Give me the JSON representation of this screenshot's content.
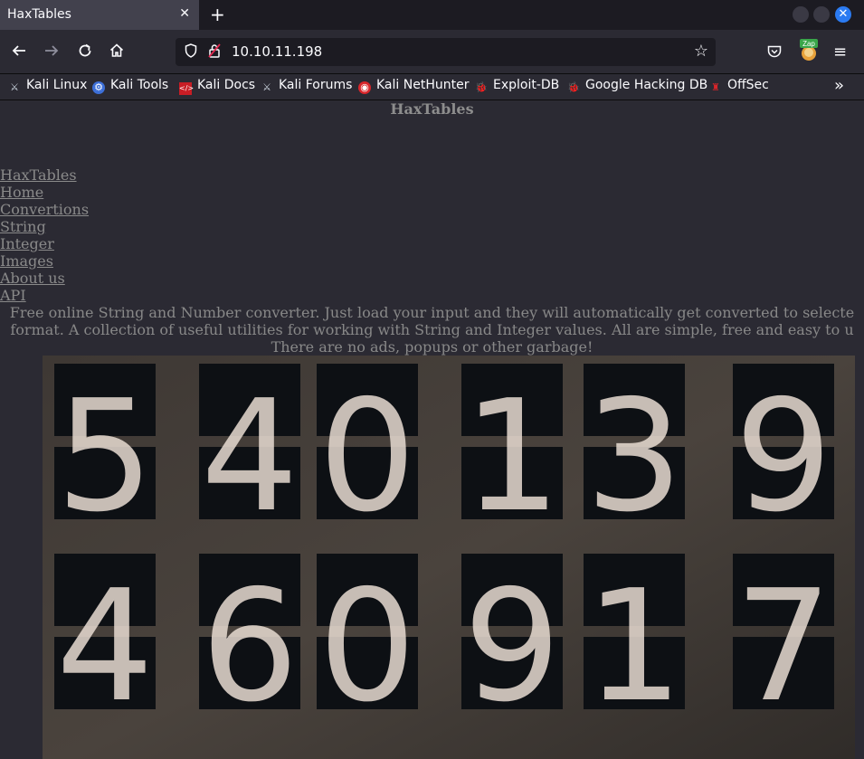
{
  "browser": {
    "tab_title": "HaxTables",
    "tab_close": "✕",
    "new_tab": "+",
    "url": "10.10.11.198",
    "zap_badge": "Zap",
    "bookmarks": [
      {
        "label": "Kali Linux",
        "icon": "kali-linux-icon"
      },
      {
        "label": "Kali Tools",
        "icon": "kali-tools-icon"
      },
      {
        "label": "Kali Docs",
        "icon": "kali-docs-icon"
      },
      {
        "label": "Kali Forums",
        "icon": "kali-forums-icon"
      },
      {
        "label": "Kali NetHunter",
        "icon": "kali-nethunter-icon"
      },
      {
        "label": "Exploit-DB",
        "icon": "exploit-db-icon"
      },
      {
        "label": "Google Hacking DB",
        "icon": "ghdb-icon"
      },
      {
        "label": "OffSec",
        "icon": "offsec-icon"
      }
    ],
    "accent": "#2b7bf2"
  },
  "page": {
    "title": "HaxTables",
    "nav": [
      "HaxTables",
      "Home",
      "Convertions",
      "String",
      "Integer",
      "Images",
      "About us",
      "API"
    ],
    "blurb_lines": [
      "Free online String and Number converter. Just load your input and they will automatically get converted to selecte",
      "format. A collection of useful utilities for working with String and Integer values. All are simple, free and easy to u",
      "There are no ads, popups or other garbage!"
    ],
    "hero_digits": [
      [
        "5",
        "4",
        "0",
        "1",
        "3",
        "9"
      ],
      [
        "4",
        "6",
        "0",
        "9",
        "1",
        "7"
      ]
    ]
  }
}
